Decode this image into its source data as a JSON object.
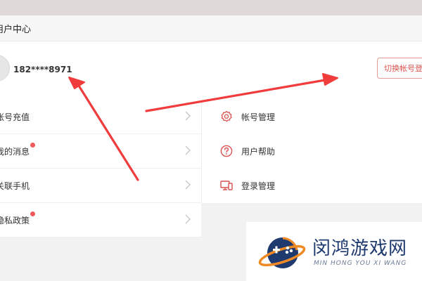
{
  "header": {
    "title": "用户中心"
  },
  "user": {
    "phone": "182****8971",
    "switch_button": "切换帐号登"
  },
  "left_menu": [
    {
      "label": "帐号充值",
      "badge": false
    },
    {
      "label": "我的消息",
      "badge": true
    },
    {
      "label": "关联手机",
      "badge": false
    },
    {
      "label": "隐私政策",
      "badge": true
    }
  ],
  "right_menu": [
    {
      "label": "帐号管理",
      "icon": "gear-icon"
    },
    {
      "label": "用户帮助",
      "icon": "help-circle-icon"
    },
    {
      "label": "登录管理",
      "icon": "devices-icon"
    }
  ],
  "watermark": {
    "title": "闵鸿游戏网",
    "subtitle": "MIN HONG YOU XI WANG"
  },
  "colors": {
    "accent": "#d9534f",
    "badge": "#f05a5a",
    "annotation": "#f03c3c",
    "watermark_text": "#1e3a6e",
    "watermark_orange": "#f08a24"
  }
}
